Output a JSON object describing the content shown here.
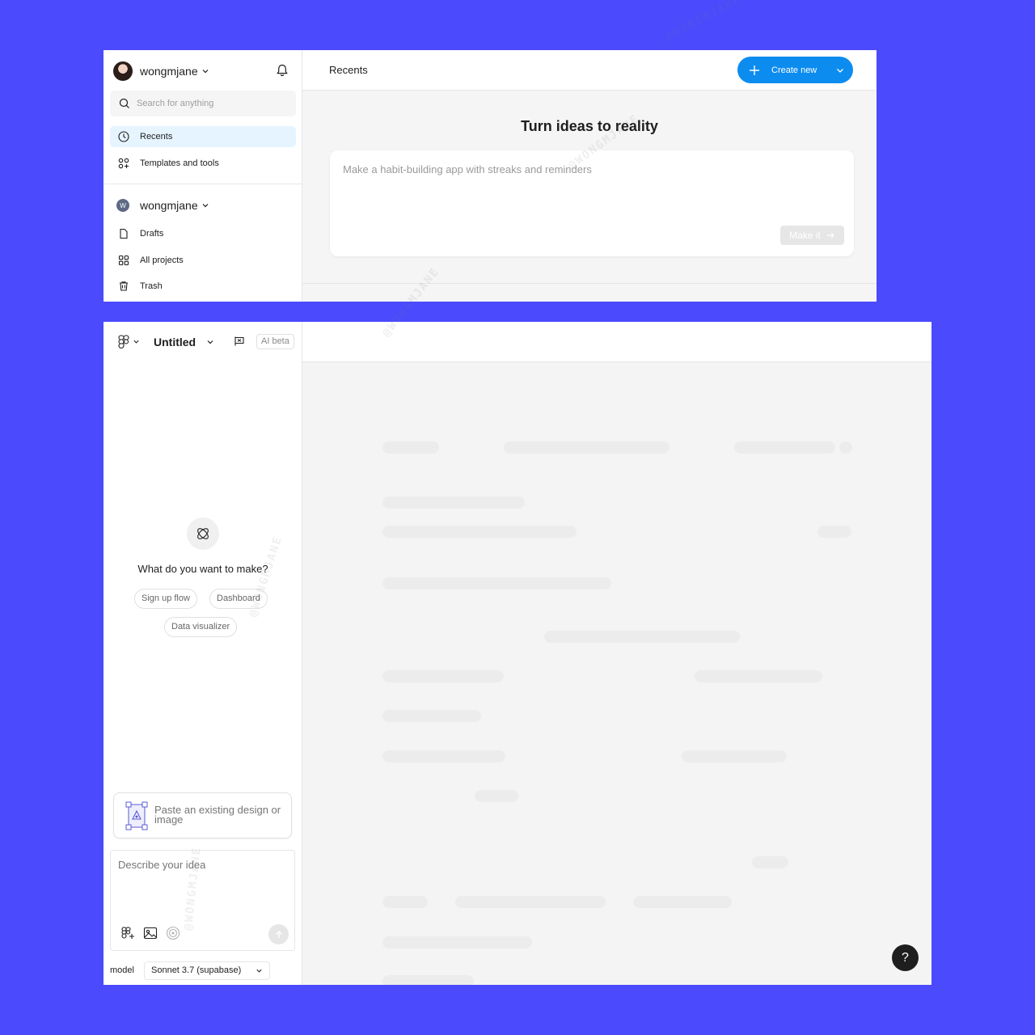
{
  "panel1": {
    "user": {
      "name": "wongmjane"
    },
    "search": {
      "placeholder": "Search for anything"
    },
    "nav": [
      {
        "label": "Recents",
        "icon": "clock-icon",
        "active": true
      },
      {
        "label": "Templates and tools",
        "icon": "templates-icon",
        "active": false
      }
    ],
    "team": {
      "name": "wongmjane",
      "initial": "W",
      "items": [
        {
          "label": "Drafts",
          "icon": "file-icon"
        },
        {
          "label": "All projects",
          "icon": "grid-icon"
        },
        {
          "label": "Trash",
          "icon": "trash-icon"
        }
      ]
    },
    "main": {
      "title": "Recents",
      "create_label": "Create new",
      "hero_title": "Turn ideas to reality",
      "hero_placeholder": "Make a habit-building app with streaks and reminders",
      "make_label": "Make it"
    }
  },
  "panel2": {
    "doc_title": "Untitled",
    "ai_badge": "AI beta",
    "question": "What do you want to make?",
    "chips": [
      "Sign up flow",
      "Dashboard",
      "Data visualizer"
    ],
    "paste_text": "Paste an existing design or image",
    "describe_placeholder": "Describe your idea",
    "model_label": "model",
    "model_value": "Sonnet 3.7 (supabase)",
    "help_label": "?"
  },
  "watermark": "@WONGMJANE",
  "colors": {
    "background": "#4b4afd",
    "accent": "#0d8cf0",
    "active_nav": "#e5f4ff",
    "canvas": "#f4f4f4"
  }
}
